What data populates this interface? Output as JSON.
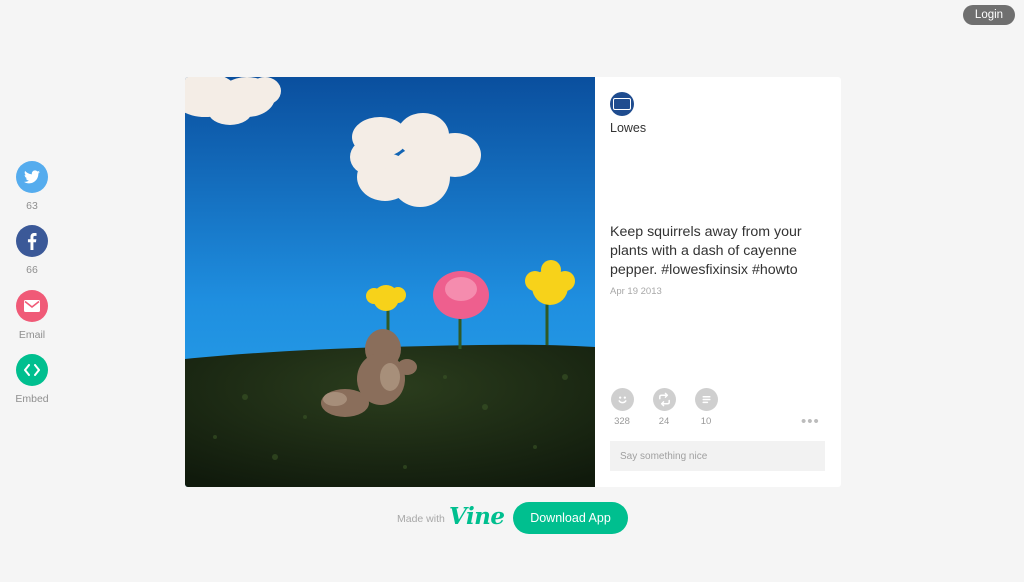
{
  "header": {
    "login_label": "Login"
  },
  "share": {
    "twitter": {
      "count": "63",
      "icon": "twitter-bird-icon",
      "color": "#55acee"
    },
    "facebook": {
      "count": "66",
      "icon": "facebook-f-icon",
      "color": "#3b5998"
    },
    "email": {
      "label": "Email",
      "icon": "envelope-icon",
      "color": "#f05a77"
    },
    "embed": {
      "label": "Embed",
      "icon": "code-brackets-icon",
      "color": "#00bf8f"
    }
  },
  "post": {
    "username": "Lowes",
    "description": "Keep squirrels away from your plants with a dash of cayenne pepper. #lowesfixinsix #howto",
    "date": "Apr 19 2013",
    "stats": {
      "likes": "328",
      "revines": "24",
      "comments": "10"
    },
    "comment_placeholder": "Say something nice"
  },
  "footer": {
    "made_with": "Made with",
    "vine_logo": "Vine",
    "download_label": "Download App"
  },
  "colors": {
    "accent": "#00bf8f",
    "background": "#f5f5f5",
    "login_bg": "#6f6f6f"
  }
}
